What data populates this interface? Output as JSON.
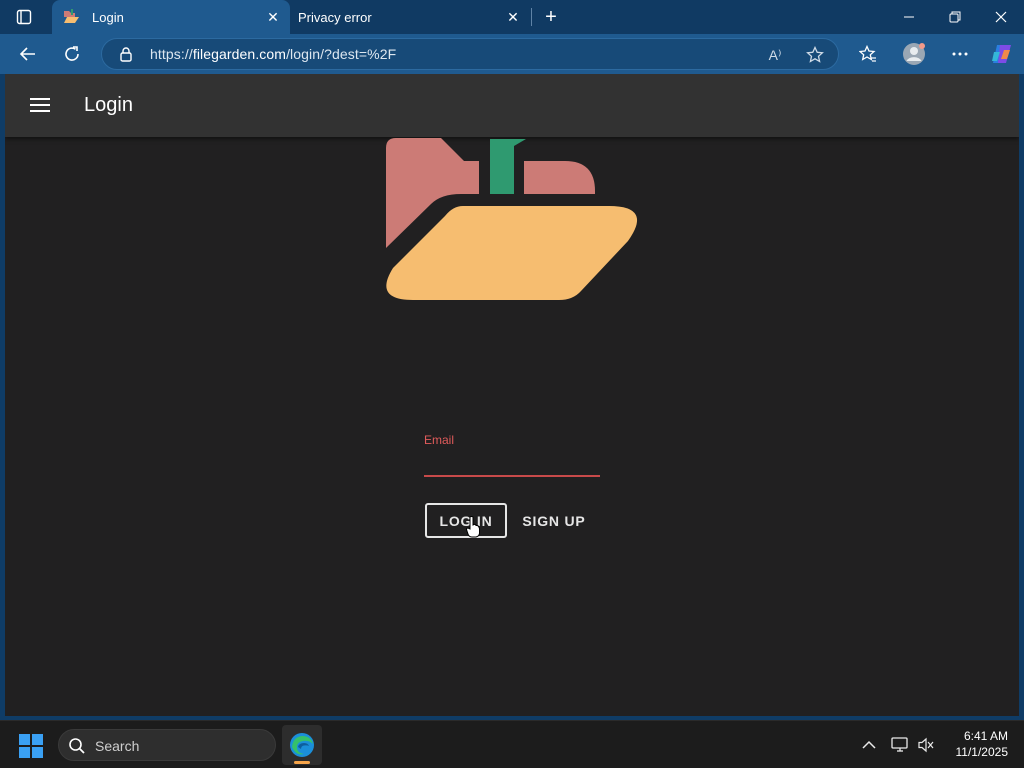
{
  "browser": {
    "tabs": [
      {
        "title": "Login",
        "active": true
      },
      {
        "title": "Privacy error",
        "active": false
      }
    ],
    "url_scheme": "https://",
    "url_host": "filegarden.com",
    "url_path": "/login/?dest=%2F",
    "read_aloud_label": "A⁾",
    "colors": {
      "frame": "#103a63",
      "active_tab": "#1f5a8f"
    }
  },
  "page": {
    "title": "Login",
    "email_label": "Email",
    "email_value": "",
    "login_label": "LOG IN",
    "signup_label": "SIGN UP",
    "colors": {
      "background": "#212021",
      "appbar": "#323232",
      "error": "#e05b5b",
      "logo_folder_back": "#cc7b76",
      "logo_folder_front": "#f6bd70",
      "logo_sprout": "#2f9a70"
    }
  },
  "taskbar": {
    "search_label": "Search",
    "time": "6:41 AM",
    "date": "11/1/2025"
  }
}
